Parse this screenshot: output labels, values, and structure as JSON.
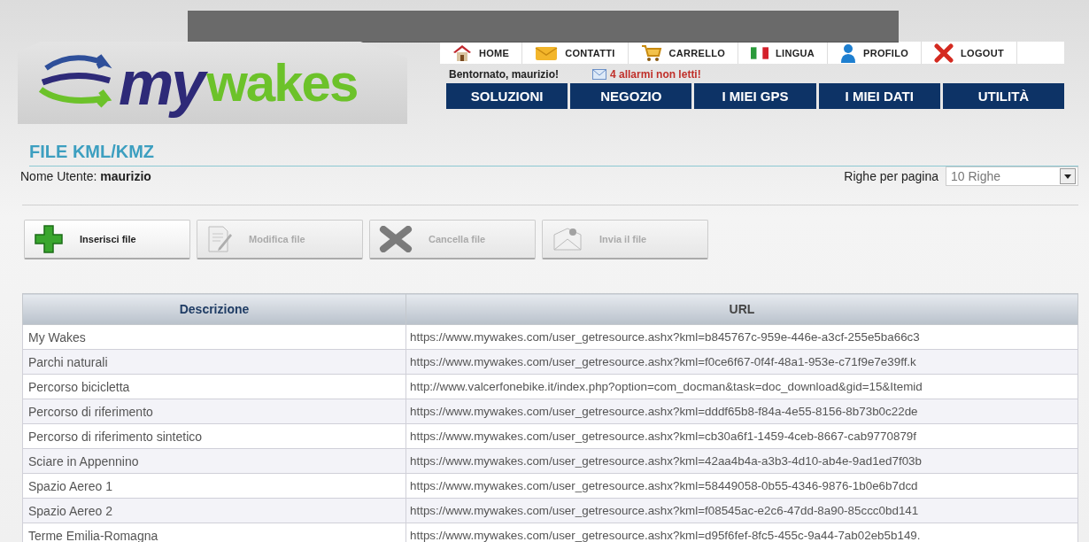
{
  "logo": {
    "text_left": "my",
    "text_right": "wakes"
  },
  "top_nav": [
    {
      "label": "HOME",
      "kind": "home"
    },
    {
      "label": "CONTATTI",
      "kind": "mail"
    },
    {
      "label": "CARRELLO",
      "kind": "cart"
    },
    {
      "label": "LINGUA",
      "kind": "flag"
    },
    {
      "label": "PROFILO",
      "kind": "user"
    },
    {
      "label": "LOGOUT",
      "kind": "close"
    }
  ],
  "welcome": "Bentornato, maurizio!",
  "alerts": "4 allarmi non letti!",
  "main_menu": [
    "SOLUZIONI",
    "NEGOZIO",
    "I MIEI GPS",
    "I MIEI DATI",
    "UTILITÀ"
  ],
  "page_title": "FILE KML/KMZ",
  "user_label": "Nome Utente:",
  "user_name": "maurizio",
  "rows_per_page": {
    "label": "Righe per pagina",
    "value": "10 Righe"
  },
  "actions": [
    {
      "label": "Inserisci file",
      "kind": "add",
      "disabled": false
    },
    {
      "label": "Modifica file",
      "kind": "edit",
      "disabled": true
    },
    {
      "label": "Cancella file",
      "kind": "delete",
      "disabled": true
    },
    {
      "label": "Invia il file",
      "kind": "send",
      "disabled": true
    }
  ],
  "table": {
    "columns": [
      "Descrizione",
      "URL"
    ],
    "rows": [
      [
        "My Wakes",
        "https://www.mywakes.com/user_getresource.ashx?kml=b845767c-959e-446e-a3cf-255e5ba66c3"
      ],
      [
        "Parchi naturali",
        "https://www.mywakes.com/user_getresource.ashx?kml=f0ce6f67-0f4f-48a1-953e-c71f9e7e39ff.k"
      ],
      [
        "Percorso bicicletta",
        "http://www.valcerfonebike.it/index.php?option=com_docman&task=doc_download&gid=15&Itemid"
      ],
      [
        "Percorso di riferimento",
        "https://www.mywakes.com/user_getresource.ashx?kml=dddf65b8-f84a-4e55-8156-8b73b0c22de"
      ],
      [
        "Percorso di riferimento sintetico",
        "https://www.mywakes.com/user_getresource.ashx?kml=cb30a6f1-1459-4ceb-8667-cab9770879f"
      ],
      [
        "Sciare in Appennino",
        "https://www.mywakes.com/user_getresource.ashx?kml=42aa4b4a-a3b3-4d10-ab4e-9ad1ed7f03b"
      ],
      [
        "Spazio Aereo 1",
        "https://www.mywakes.com/user_getresource.ashx?kml=58449058-0b55-4346-9876-1b0e6b7dcd"
      ],
      [
        "Spazio Aereo 2",
        "https://www.mywakes.com/user_getresource.ashx?kml=f08545ac-e2c6-47dd-8a90-85ccc0bd141"
      ],
      [
        "Terme Emilia-Romagna",
        "https://www.mywakes.com/user_getresource.ashx?kml=d95f6fef-8fc5-455c-9a44-7ab02eb5b149."
      ]
    ]
  }
}
